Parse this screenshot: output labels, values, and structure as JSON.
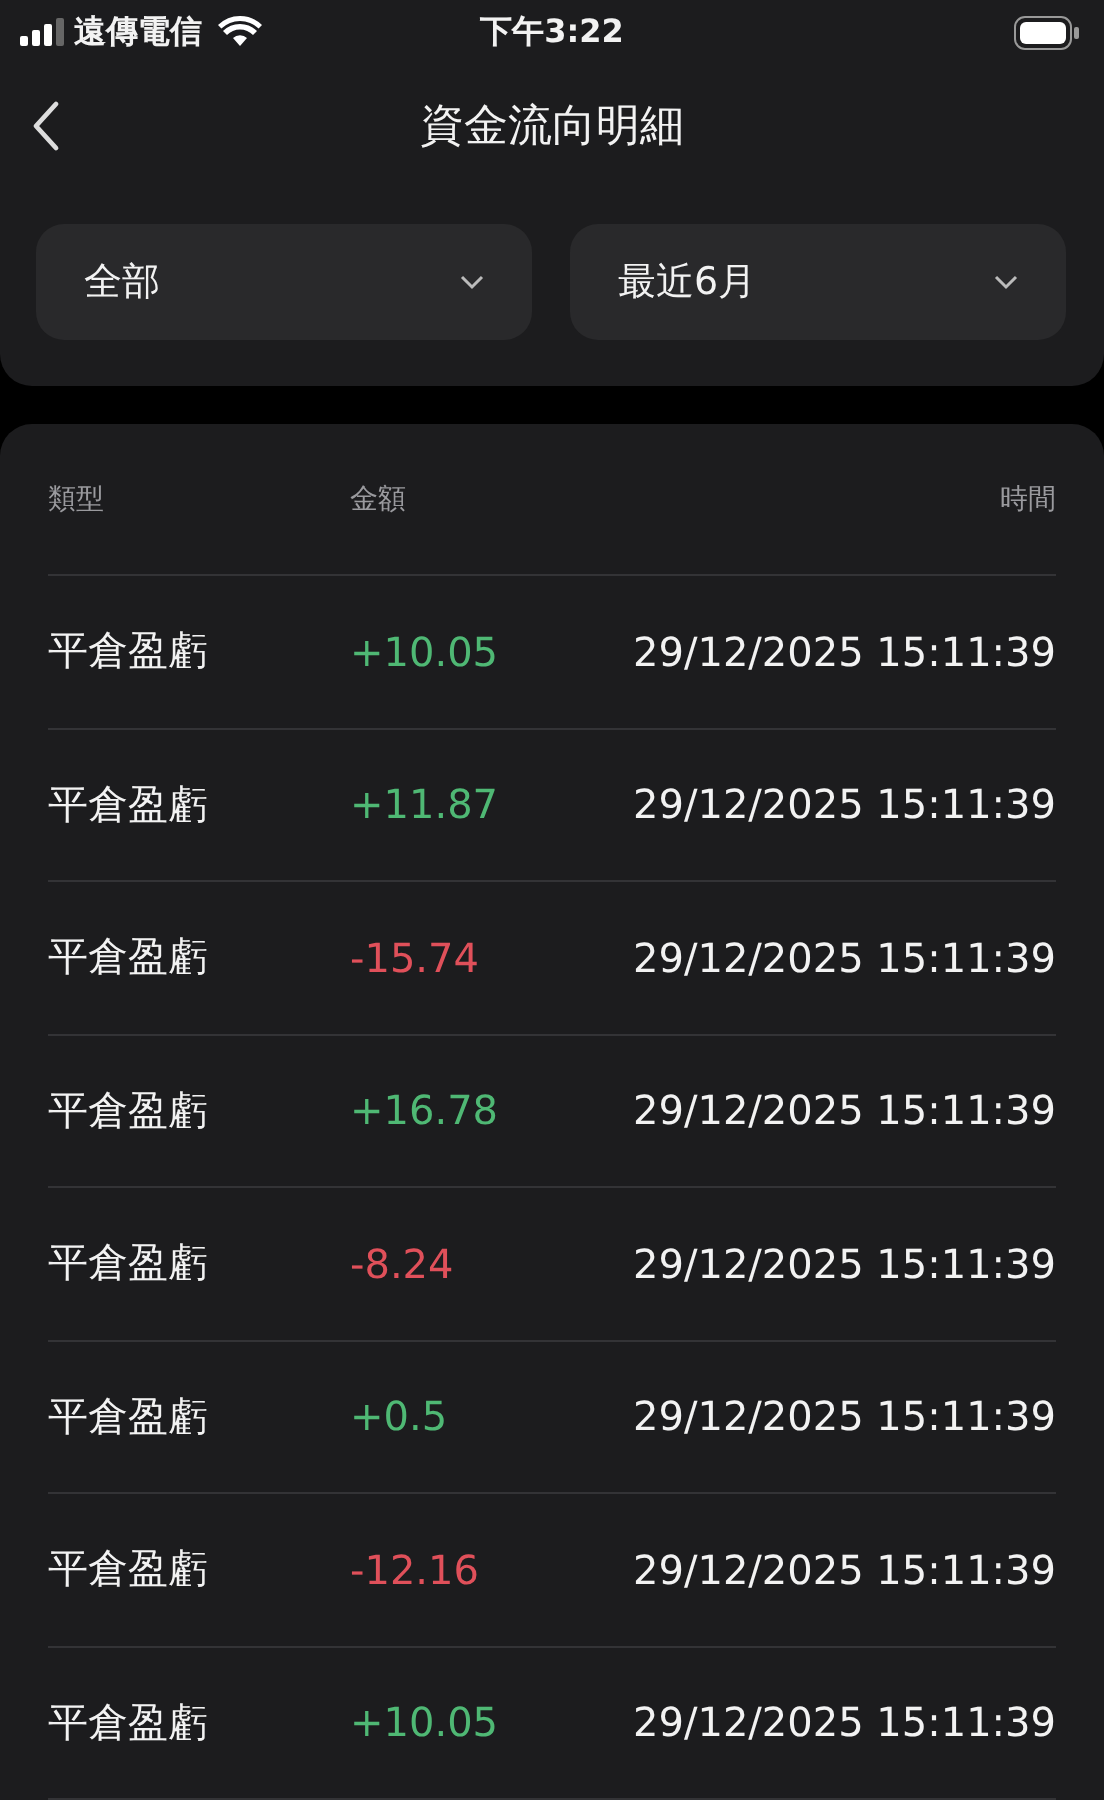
{
  "status_bar": {
    "carrier": "遠傳電信",
    "time": "下午3:22"
  },
  "header": {
    "title": "資金流向明細"
  },
  "filters": [
    {
      "label": "全部"
    },
    {
      "label": "最近6月"
    }
  ],
  "table": {
    "columns": [
      "類型",
      "金額",
      "時間"
    ],
    "rows": [
      {
        "type": "平倉盈虧",
        "amount": "+10.05",
        "kind": "gain",
        "time": "29/12/2025 15:11:39"
      },
      {
        "type": "平倉盈虧",
        "amount": "+11.87",
        "kind": "gain",
        "time": "29/12/2025 15:11:39"
      },
      {
        "type": "平倉盈虧",
        "amount": "-15.74",
        "kind": "loss",
        "time": "29/12/2025 15:11:39"
      },
      {
        "type": "平倉盈虧",
        "amount": "+16.78",
        "kind": "gain",
        "time": "29/12/2025 15:11:39"
      },
      {
        "type": "平倉盈虧",
        "amount": "-8.24",
        "kind": "loss",
        "time": "29/12/2025 15:11:39"
      },
      {
        "type": "平倉盈虧",
        "amount": "+0.5",
        "kind": "gain",
        "time": "29/12/2025 15:11:39"
      },
      {
        "type": "平倉盈虧",
        "amount": "-12.16",
        "kind": "loss",
        "time": "29/12/2025 15:11:39"
      },
      {
        "type": "平倉盈虧",
        "amount": "+10.05",
        "kind": "gain",
        "time": "29/12/2025 15:11:39"
      }
    ]
  }
}
